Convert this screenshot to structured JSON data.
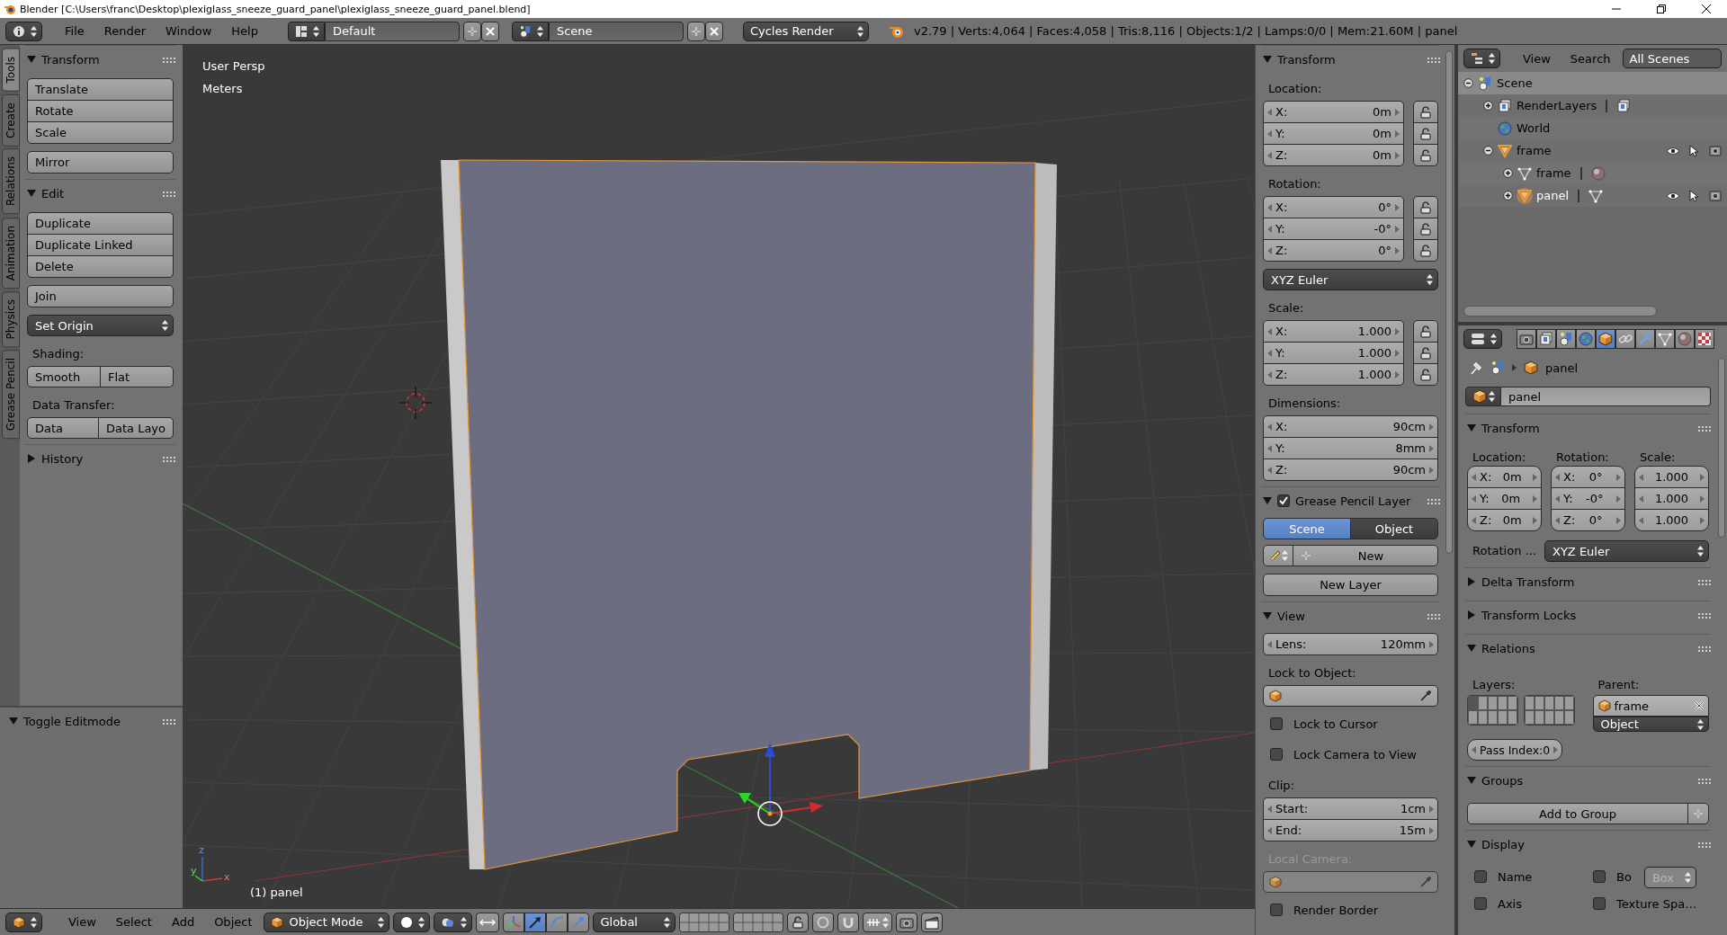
{
  "title_bar": {
    "title": "Blender [C:\\Users\\franc\\Desktop\\plexiglass_sneeze_guard_panel\\plexiglass_sneeze_guard_panel.blend]"
  },
  "info_header": {
    "menus": [
      "File",
      "Render",
      "Window",
      "Help"
    ],
    "layout": "Default",
    "scene": "Scene",
    "engine": "Cycles Render",
    "stats": "v2.79 | Verts:4,064 | Faces:4,058 | Tris:8,116 | Objects:1/2 | Lamps:0/0 | Mem:21.60M | panel"
  },
  "tool_tabs": [
    {
      "label": "Tools",
      "selected": true
    },
    {
      "label": "Create",
      "selected": false
    },
    {
      "label": "Relations",
      "selected": false
    },
    {
      "label": "Animation",
      "selected": false
    },
    {
      "label": "Physics",
      "selected": false
    },
    {
      "label": "Grease Pencil",
      "selected": false
    }
  ],
  "tool_shelf": {
    "sections": [
      {
        "title": "Transform",
        "expanded": true,
        "items": [
          {
            "kind": "stack",
            "labels": [
              "Translate",
              "Rotate",
              "Scale"
            ]
          },
          {
            "kind": "stack",
            "labels": [
              "Mirror"
            ]
          }
        ]
      },
      {
        "title": "Edit",
        "expanded": true,
        "items": [
          {
            "kind": "stack",
            "labels": [
              "Duplicate",
              "Duplicate Linked",
              "Delete"
            ]
          },
          {
            "kind": "stack",
            "labels": [
              "Join"
            ]
          },
          {
            "kind": "dropdown",
            "label": "Set Origin"
          },
          {
            "kind": "label",
            "text": "Shading:"
          },
          {
            "kind": "split",
            "labels": [
              "Smooth",
              "Flat"
            ]
          },
          {
            "kind": "label",
            "text": "Data Transfer:"
          },
          {
            "kind": "split",
            "labels": [
              "Data",
              "Data Layo"
            ]
          }
        ]
      },
      {
        "title": "History",
        "expanded": false
      }
    ]
  },
  "operator_panel": {
    "title": "Toggle Editmode",
    "expanded": true
  },
  "viewport": {
    "view_name": "User Persp",
    "units": "Meters",
    "axis_labels": [
      "z",
      "y",
      "x"
    ],
    "active_object": "(1) panel"
  },
  "viewport_header": {
    "menus": [
      "View",
      "Select",
      "Add",
      "Object"
    ],
    "mode": "Object Mode",
    "orientation": "Global",
    "manipulators": [
      {
        "kind": "toggle",
        "selected": false
      },
      {
        "kind": "translate",
        "selected": true
      },
      {
        "kind": "rotate",
        "selected": false
      },
      {
        "kind": "scale",
        "selected": false
      }
    ]
  },
  "properties_region": {
    "sections": [
      {
        "title": "Transform",
        "expanded": true,
        "items": [
          {
            "kind": "label",
            "text": "Location:"
          },
          {
            "kind": "fields",
            "locks": true,
            "rows": [
              {
                "label": "X:",
                "value": "0m"
              },
              {
                "label": "Y:",
                "value": "0m"
              },
              {
                "label": "Z:",
                "value": "0m"
              }
            ]
          },
          {
            "kind": "label",
            "text": "Rotation:"
          },
          {
            "kind": "fields",
            "locks": true,
            "rows": [
              {
                "label": "X:",
                "value": "0°"
              },
              {
                "label": "Y:",
                "value": "-0°"
              },
              {
                "label": "Z:",
                "value": "0°"
              }
            ]
          },
          {
            "kind": "dropdown",
            "label": "XYZ Euler"
          },
          {
            "kind": "label",
            "text": "Scale:"
          },
          {
            "kind": "fields",
            "locks": true,
            "rows": [
              {
                "label": "X:",
                "value": "1.000"
              },
              {
                "label": "Y:",
                "value": "1.000"
              },
              {
                "label": "Z:",
                "value": "1.000"
              }
            ]
          },
          {
            "kind": "label",
            "text": "Dimensions:"
          },
          {
            "kind": "fields",
            "locks": false,
            "rows": [
              {
                "label": "X:",
                "value": "90cm"
              },
              {
                "label": "Y:",
                "value": "8mm"
              },
              {
                "label": "Z:",
                "value": "90cm"
              }
            ]
          }
        ]
      },
      {
        "title": "Grease Pencil Layer",
        "expanded": true,
        "checked": true,
        "items": [
          {
            "kind": "toggle",
            "options": [
              {
                "label": "Scene",
                "selected": true
              },
              {
                "label": "Object",
                "selected": false
              }
            ]
          },
          {
            "kind": "new_row",
            "label": "New"
          },
          {
            "kind": "stack",
            "labels": [
              "New Layer"
            ],
            "centered": true
          }
        ]
      },
      {
        "title": "View",
        "expanded": true,
        "items": [
          {
            "kind": "fields",
            "locks": false,
            "rows": [
              {
                "label": "Lens:",
                "value": "120mm"
              }
            ]
          },
          {
            "kind": "label",
            "text": "Lock to Object:"
          },
          {
            "kind": "object_field",
            "disabled": false
          },
          {
            "kind": "checkbox",
            "label": "Lock to Cursor",
            "checked": false
          },
          {
            "kind": "checkbox",
            "label": "Lock Camera to View",
            "checked": false
          },
          {
            "kind": "label",
            "text": "Clip:"
          },
          {
            "kind": "fields",
            "locks": false,
            "rows": [
              {
                "label": "Start:",
                "value": "1cm"
              },
              {
                "label": "End:",
                "value": "15m"
              }
            ]
          },
          {
            "kind": "label",
            "text": "Local Camera:",
            "disabled": true
          },
          {
            "kind": "object_field",
            "disabled": true
          },
          {
            "kind": "checkbox",
            "label": "Render Border",
            "checked": false
          }
        ]
      }
    ]
  },
  "outliner": {
    "menus": [
      "View",
      "Search"
    ],
    "display_mode": "All Scenes",
    "tree": [
      {
        "label": "Scene",
        "kind": "scene",
        "expanded": true,
        "selected": true,
        "active": false,
        "restrict": false,
        "children": [
          {
            "label": "RenderLayers",
            "kind": "renderlayers",
            "expanded": false,
            "selected": false,
            "active": false,
            "restrict": false,
            "extra": {
              "kind": "renderlayers"
            }
          },
          {
            "label": "World",
            "kind": "world",
            "selected": false,
            "active": false,
            "restrict": false
          },
          {
            "label": "frame",
            "kind": "object",
            "expanded": true,
            "selected": false,
            "active": false,
            "restrict": true,
            "children": [
              {
                "label": "frame",
                "kind": "mesh",
                "expanded": false,
                "selected": false,
                "active": false,
                "restrict": false,
                "extra": {
                  "kind": "material"
                }
              },
              {
                "label": "panel",
                "kind": "object",
                "expanded": false,
                "selected": false,
                "active": true,
                "restrict": true,
                "extra": {
                  "kind": "mesh"
                }
              }
            ]
          }
        ]
      }
    ]
  },
  "properties": {
    "tabs": [
      {
        "kind": "render",
        "selected": false
      },
      {
        "kind": "renderlayers",
        "selected": false
      },
      {
        "kind": "scene",
        "selected": false
      },
      {
        "kind": "world",
        "selected": false
      },
      {
        "kind": "object",
        "selected": true
      },
      {
        "kind": "constraints",
        "selected": false
      },
      {
        "kind": "modifiers",
        "selected": false
      },
      {
        "kind": "data",
        "selected": false
      },
      {
        "kind": "material",
        "selected": false
      },
      {
        "kind": "texture",
        "selected": false
      }
    ],
    "breadcrumb": "panel",
    "name": "panel",
    "sections": [
      {
        "title": "Transform",
        "expanded": true,
        "items": [
          {
            "kind": "columns",
            "columns": [
              {
                "label": "Location:",
                "rows": [
                  {
                    "label": "X:",
                    "value": "0m"
                  },
                  {
                    "label": "Y:",
                    "value": "0m"
                  },
                  {
                    "label": "Z:",
                    "value": "0m"
                  }
                ]
              },
              {
                "label": "Rotation:",
                "rows": [
                  {
                    "label": "X:",
                    "value": "0°"
                  },
                  {
                    "label": "Y:",
                    "value": "-0°"
                  },
                  {
                    "label": "Z:",
                    "value": "0°"
                  }
                ]
              },
              {
                "label": "Scale:",
                "rows": [
                  {
                    "value": "1.000"
                  },
                  {
                    "value": "1.000"
                  },
                  {
                    "value": "1.000"
                  }
                ]
              }
            ]
          },
          {
            "kind": "labeled_dropdown",
            "label": "Rotation ...",
            "value": "XYZ Euler"
          }
        ]
      },
      {
        "title": "Delta Transform",
        "expanded": false
      },
      {
        "title": "Transform Locks",
        "expanded": false
      },
      {
        "title": "Relations",
        "expanded": true,
        "items": [
          {
            "kind": "relations",
            "layers_label": "Layers:",
            "parent_label": "Parent:",
            "parent": "frame",
            "parent_type": "Object",
            "layers": [
              true,
              false,
              false,
              false,
              false,
              false,
              false,
              false,
              false,
              false,
              false,
              false,
              false,
              false,
              false,
              false,
              false,
              false,
              false,
              false
            ]
          },
          {
            "kind": "spinner",
            "label": "Pass Index:0"
          }
        ]
      },
      {
        "title": "Groups",
        "expanded": true,
        "items": [
          {
            "kind": "add_button",
            "label": "Add to Group"
          }
        ]
      },
      {
        "title": "Display",
        "expanded": true,
        "items": [
          {
            "kind": "check_rows",
            "rows": [
              [
                {
                  "kind": "checkbox",
                  "label": "Name",
                  "checked": false
                },
                {
                  "kind": "checkbox",
                  "label": "Bo",
                  "checked": false
                },
                {
                  "kind": "dropdown",
                  "label": "Box",
                  "disabled": true
                }
              ],
              [
                {
                  "kind": "checkbox",
                  "label": "Axis",
                  "checked": false
                },
                {
                  "kind": "checkbox",
                  "label": "Texture Spa…",
                  "checked": false
                }
              ]
            ]
          }
        ]
      }
    ]
  }
}
